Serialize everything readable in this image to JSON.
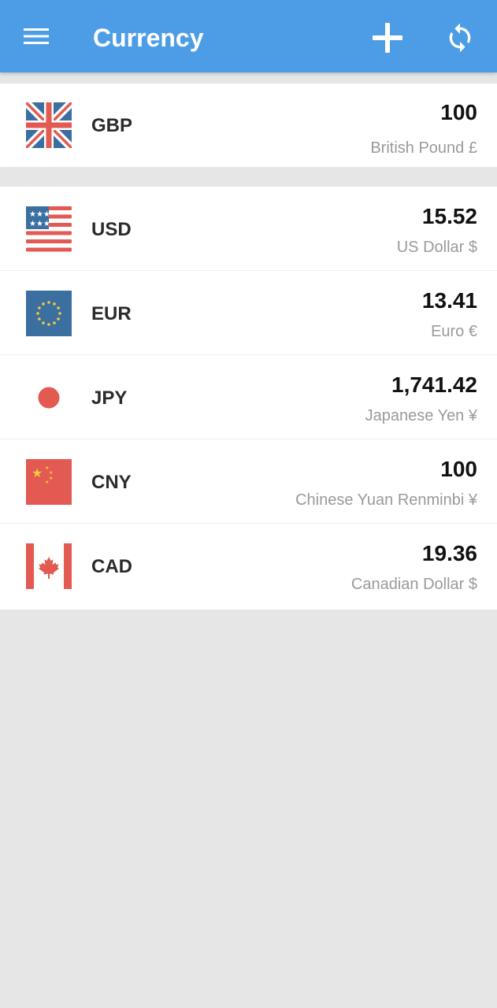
{
  "header": {
    "title": "Currency",
    "color": "#4d9de6"
  },
  "icons": {
    "menu": "menu-icon",
    "add": "plus-icon",
    "refresh": "refresh-icon"
  },
  "base": {
    "code": "GBP",
    "amount": "100",
    "name": "British Pound",
    "symbol": "£",
    "flag": "uk-flag-icon"
  },
  "currencies": [
    {
      "code": "USD",
      "amount": "15.52",
      "name": "US Dollar",
      "symbol": "$",
      "flag": "us-flag-icon"
    },
    {
      "code": "EUR",
      "amount": "13.41",
      "name": "Euro",
      "symbol": "€",
      "flag": "eu-flag-icon"
    },
    {
      "code": "JPY",
      "amount": "1,741.42",
      "name": "Japanese Yen",
      "symbol": "¥",
      "flag": "japan-flag-icon"
    },
    {
      "code": "CNY",
      "amount": "100",
      "name": "Chinese Yuan Renminbi",
      "symbol": "¥",
      "flag": "china-flag-icon"
    },
    {
      "code": "CAD",
      "amount": "19.36",
      "name": "Canadian Dollar",
      "symbol": "$",
      "flag": "canada-flag-icon"
    }
  ]
}
